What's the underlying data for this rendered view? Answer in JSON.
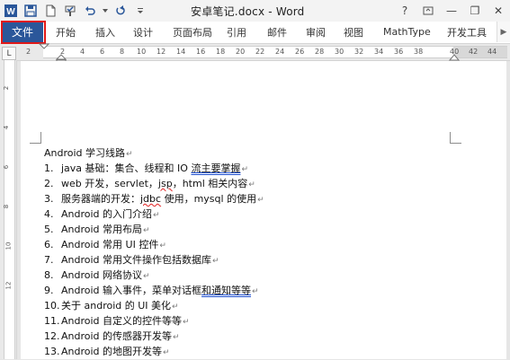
{
  "window": {
    "title": "安卓笔记.docx - Word",
    "controls": {
      "help": "?",
      "minimize": "—",
      "restore": "❐",
      "close": "✕"
    }
  },
  "ribbon": {
    "file": "文件",
    "tabs": [
      "开始",
      "插入",
      "设计",
      "页面布局",
      "引用",
      "邮件",
      "审阅",
      "视图",
      "MathType",
      "开发工具"
    ]
  },
  "ruler": {
    "horizontal": [
      "2",
      "2",
      "4",
      "6",
      "8",
      "10",
      "12",
      "14",
      "16",
      "18",
      "20",
      "22",
      "24",
      "26",
      "28",
      "30",
      "32",
      "34",
      "36",
      "38",
      "40",
      "42",
      "44"
    ],
    "vertical": [
      "2",
      "4",
      "6",
      "8",
      "10",
      "12"
    ]
  },
  "document": {
    "heading": "Android 学习线路",
    "items": [
      {
        "num": "1.",
        "text": "java 基础：集合、线程和 IO ",
        "marked": "流主要掌握",
        "rest": ""
      },
      {
        "num": "2.",
        "text": "web 开发，servlet，",
        "marked": "jsp",
        "rest": "，html 相关内容"
      },
      {
        "num": "3.",
        "text": "服务器端的开发：",
        "marked": "jdbc",
        "rest": " 使用，mysql 的使用"
      },
      {
        "num": "4.",
        "text": "Android 的入门介绍",
        "marked": "",
        "rest": ""
      },
      {
        "num": "5.",
        "text": "Android 常用布局",
        "marked": "",
        "rest": ""
      },
      {
        "num": "6.",
        "text": "Android 常用 UI 控件",
        "marked": "",
        "rest": ""
      },
      {
        "num": "7.",
        "text": "Android 常用文件操作包括数据库",
        "marked": "",
        "rest": ""
      },
      {
        "num": "8.",
        "text": "Android 网络协议",
        "marked": "",
        "rest": ""
      },
      {
        "num": "9.",
        "text": "Android 输入事件，菜单对话框",
        "marked": "和通知等等",
        "rest": ""
      },
      {
        "num": "10.",
        "text": "关于 android 的 UI 美化",
        "marked": "",
        "rest": ""
      },
      {
        "num": "11.",
        "text": "Android 自定义的控件等等",
        "marked": "",
        "rest": ""
      },
      {
        "num": "12.",
        "text": "Android 的传感器开发等",
        "marked": "",
        "rest": ""
      },
      {
        "num": "13.",
        "text": "Android 的地图开发等",
        "marked": "",
        "rest": ""
      }
    ],
    "para_mark": "↵"
  },
  "colors": {
    "file_tab": "#2b579a",
    "highlight": "#e01818"
  }
}
